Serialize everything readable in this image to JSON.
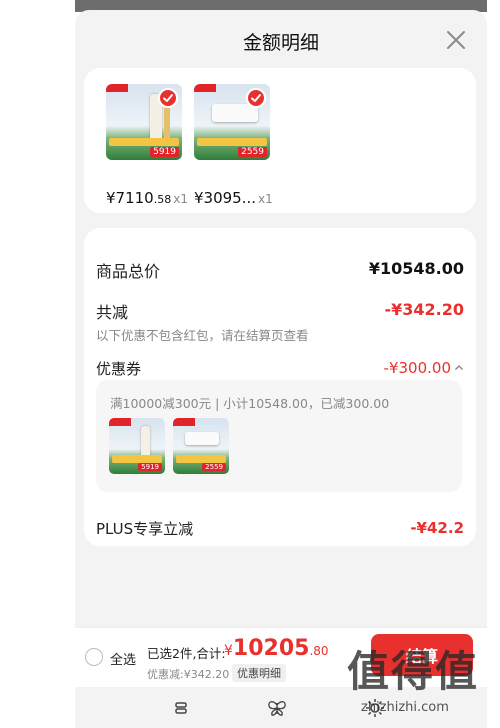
{
  "sheet": {
    "title": "金额明细"
  },
  "products": [
    {
      "price_int": "¥7110",
      "price_dec": ".58",
      "qty": "x1",
      "thumb_price": "5919"
    },
    {
      "price_int": "¥3095...",
      "price_dec": "",
      "qty": "x1",
      "thumb_price": "2559"
    }
  ],
  "summary": {
    "total_label": "商品总价",
    "total_value": "¥10548.00",
    "reduce_label": "共减",
    "reduce_value": "-¥342.20",
    "reduce_note": "以下优惠不包含红包，请在结算页查看",
    "coupon_label": "优惠券",
    "coupon_value": "-¥300.00",
    "coupon_desc": "满10000减300元 | 小计10548.00，已减300.00",
    "coupon_thumb_prices": [
      "5919",
      "2559"
    ],
    "plus_label": "PLUS专享立减",
    "plus_value": "-¥42.2"
  },
  "footer": {
    "select_all": "全选",
    "selected": "已选2件,合计:",
    "total_currency": "¥",
    "total_int": "10205",
    "total_dec": ".80",
    "discount": "优惠减:¥342.20",
    "detail_tag": "优惠明细",
    "checkout_label": "结算"
  },
  "nav": {
    "icons": [
      "menu-icon",
      "butterfly-icon",
      "gear-icon"
    ]
  },
  "watermark": {
    "big": "值得值",
    "small": "zhizhizhi.com"
  },
  "colors": {
    "accent": "#e8312f",
    "sheet_bg": "#f3f3f3",
    "card_bg": "#ffffff"
  }
}
